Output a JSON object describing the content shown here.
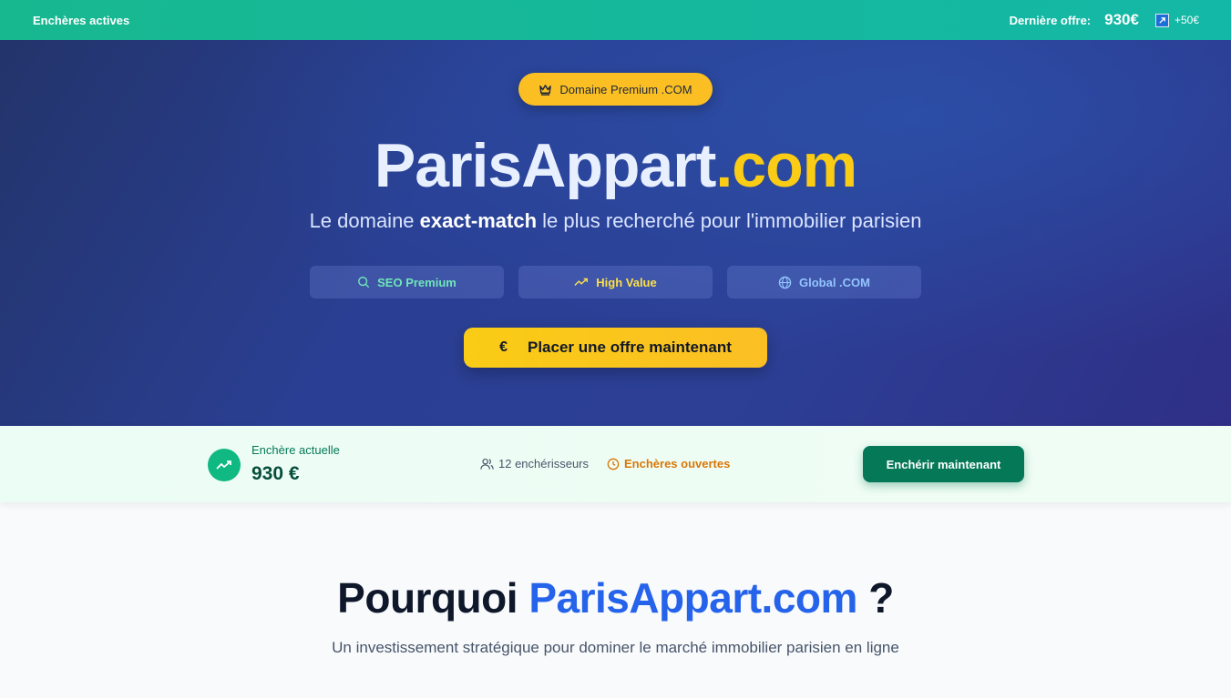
{
  "topbar": {
    "status": "Enchères actives",
    "last_offer_label": "Dernière offre:",
    "last_offer_value": "930€",
    "increment": "+50€"
  },
  "hero": {
    "badge": "Domaine Premium .COM",
    "title_name": "ParisAppart",
    "title_tld": ".com",
    "subtitle_pre": "Le domaine ",
    "subtitle_bold": "exact-match",
    "subtitle_post": " le plus recherché pour l'immobilier parisien",
    "pills": [
      {
        "label": "SEO Premium",
        "icon": "search-icon"
      },
      {
        "label": "High Value",
        "icon": "trending-up-icon"
      },
      {
        "label": "Global .COM",
        "icon": "globe-icon"
      }
    ],
    "cta_symbol": "€",
    "cta_label": "Placer une offre maintenant"
  },
  "auction": {
    "current_label": "Enchère actuelle",
    "current_value": "930 €",
    "bidders": "12 enchérisseurs",
    "status": "Enchères ouvertes",
    "bid_button": "Enchérir maintenant"
  },
  "why": {
    "title_pre": "Pourquoi ",
    "title_brand": "ParisAppart.com",
    "title_post": " ?",
    "subtitle": "Un investissement stratégique pour dominer le marché immobilier parisien en ligne"
  },
  "colors": {
    "topbar": "#17b890",
    "hero": "#2a3f93",
    "accent_yellow": "#fbbf24",
    "brand_blue": "#2563eb",
    "green_button": "#047857"
  }
}
